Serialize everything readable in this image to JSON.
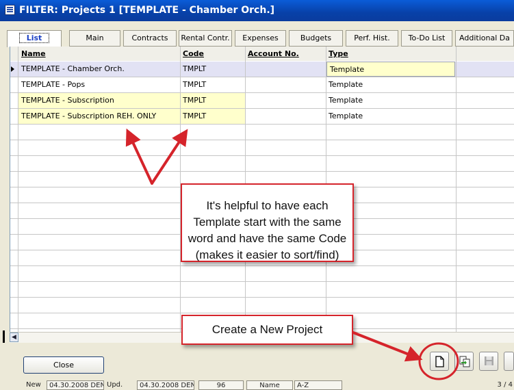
{
  "window": {
    "title": "FILTER: Projects  1 [TEMPLATE - Chamber Orch.]"
  },
  "tabs": [
    {
      "label": "List",
      "active": true
    },
    {
      "label": "Main"
    },
    {
      "label": "Contracts"
    },
    {
      "label": "Rental Contr."
    },
    {
      "label": "Expenses"
    },
    {
      "label": "Budgets"
    },
    {
      "label": "Perf. Hist."
    },
    {
      "label": "To-Do List"
    },
    {
      "label": "Additional Da"
    }
  ],
  "grid": {
    "columns": [
      "Name",
      "Code",
      "Account No.",
      "Type"
    ],
    "rows": [
      {
        "name": "TEMPLATE - Chamber Orch.",
        "code": "TMPLT",
        "account": "",
        "type": "Template",
        "selected": true
      },
      {
        "name": "TEMPLATE - Pops",
        "code": "TMPLT",
        "account": "",
        "type": "Template"
      },
      {
        "name": "TEMPLATE - Subscription",
        "code": "TMPLT",
        "account": "",
        "type": "Template"
      },
      {
        "name": "TEMPLATE - Subscription REH. ONLY",
        "code": "TMPLT",
        "account": "",
        "type": "Template"
      }
    ],
    "highlight_color": "#FFFFCC",
    "selected_color": "#E2E2F4"
  },
  "buttons": {
    "close": "Close"
  },
  "toolbar_icons": [
    "new-document-icon",
    "copy-record-icon",
    "save-icon",
    "extra-icon"
  ],
  "statusbar": {
    "new_label": "New",
    "new_date": "04.30.2008 DEN",
    "upd_label": "Upd.",
    "upd_date": "04.30.2008 DEN",
    "count": "96",
    "sort_field": "Name",
    "sort_order": "A-Z",
    "record_pos": "3 / 4"
  },
  "annotations": {
    "callout_main": "It's helpful to have each Template start with the same word and have the same Code (makes it easier to sort/find)",
    "callout_new": "Create a New Project",
    "accent_color": "#D5242B"
  }
}
